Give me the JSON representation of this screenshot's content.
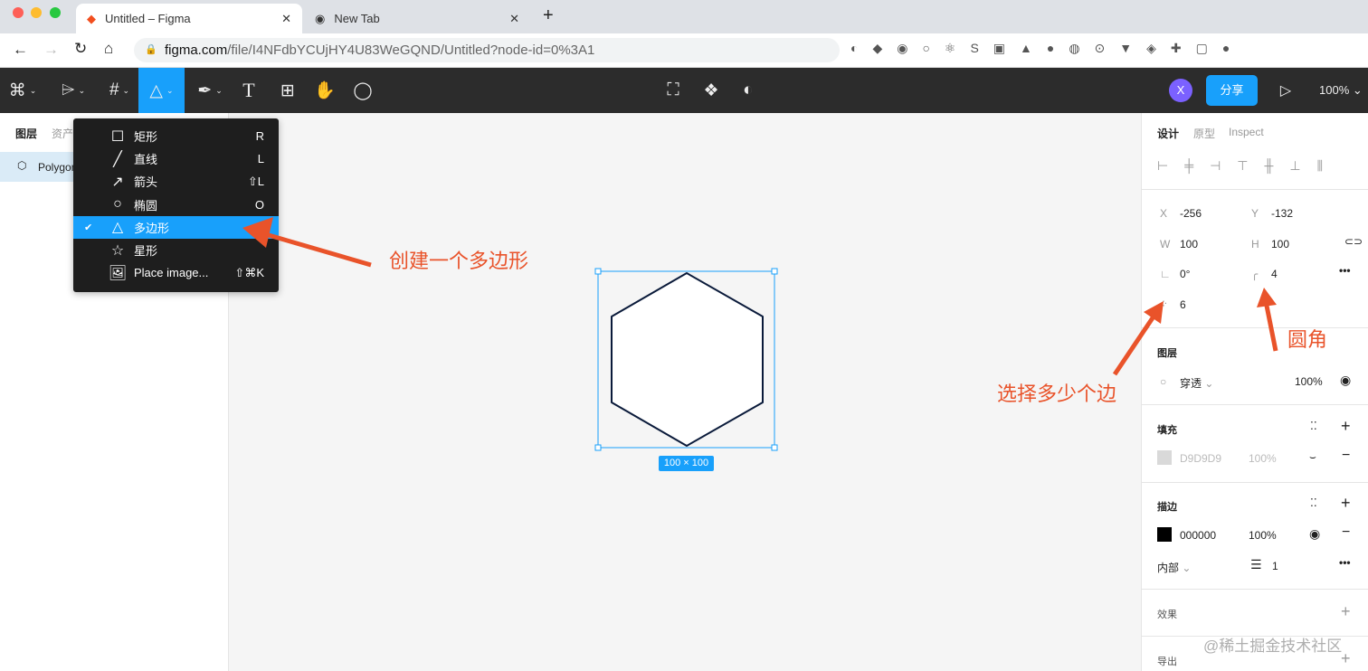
{
  "browser": {
    "tabs": [
      {
        "title": "Untitled – Figma",
        "active": true
      },
      {
        "title": "New Tab",
        "active": false
      }
    ],
    "url_domain": "figma.com",
    "url_path": "/file/I4NFdbYCUjHY4U83WeGQND/Untitled?node-id=0%3A1"
  },
  "toolbar": {
    "tools": [
      "main-menu",
      "move",
      "frame",
      "shape",
      "pen",
      "text",
      "resources",
      "hand",
      "comment"
    ],
    "avatar": "X",
    "share_label": "分享",
    "zoom": "100%"
  },
  "shape_menu": {
    "items": [
      {
        "label": "矩形",
        "shortcut": "R",
        "icon": "rectangle-icon"
      },
      {
        "label": "直线",
        "shortcut": "L",
        "icon": "line-icon"
      },
      {
        "label": "箭头",
        "shortcut": "⇧L",
        "icon": "arrow-icon"
      },
      {
        "label": "椭圆",
        "shortcut": "O",
        "icon": "ellipse-icon"
      },
      {
        "label": "多边形",
        "shortcut": "",
        "icon": "polygon-icon",
        "selected": true
      },
      {
        "label": "星形",
        "shortcut": "",
        "icon": "star-icon"
      },
      {
        "label": "Place image...",
        "shortcut": "⇧⌘K",
        "icon": "image-icon"
      }
    ]
  },
  "left_panel": {
    "tabs": [
      "图层",
      "资产"
    ],
    "layers": [
      {
        "name": "Polygon 1"
      }
    ]
  },
  "canvas": {
    "size_label": "100 × 100"
  },
  "annotations": {
    "create_polygon": "创建一个多边形",
    "choose_sides": "选择多少个边",
    "corner_radius": "圆角",
    "watermark": "@稀土掘金技术社区"
  },
  "design_panel": {
    "tabs": [
      "设计",
      "原型",
      "Inspect"
    ],
    "x_label": "X",
    "x": "-256",
    "y_label": "Y",
    "y": "-132",
    "w_label": "W",
    "w": "100",
    "h_label": "H",
    "h": "100",
    "rotation": "0°",
    "radius": "4",
    "count": "6",
    "layer": {
      "title": "图层",
      "blend": "穿透",
      "opacity": "100%"
    },
    "fill": {
      "title": "填充",
      "color": "D9D9D9",
      "opacity": "100%",
      "swatch": "#d9d9d9"
    },
    "stroke": {
      "title": "描边",
      "color": "000000",
      "opacity": "100%",
      "swatch": "#000000",
      "position": "内部",
      "weight": "1"
    },
    "effects": {
      "title": "效果"
    },
    "export": {
      "title": "导出"
    }
  },
  "colors": {
    "accent": "#18a0fb",
    "annotation": "#e9532a",
    "toolbar": "#2c2c2c"
  }
}
